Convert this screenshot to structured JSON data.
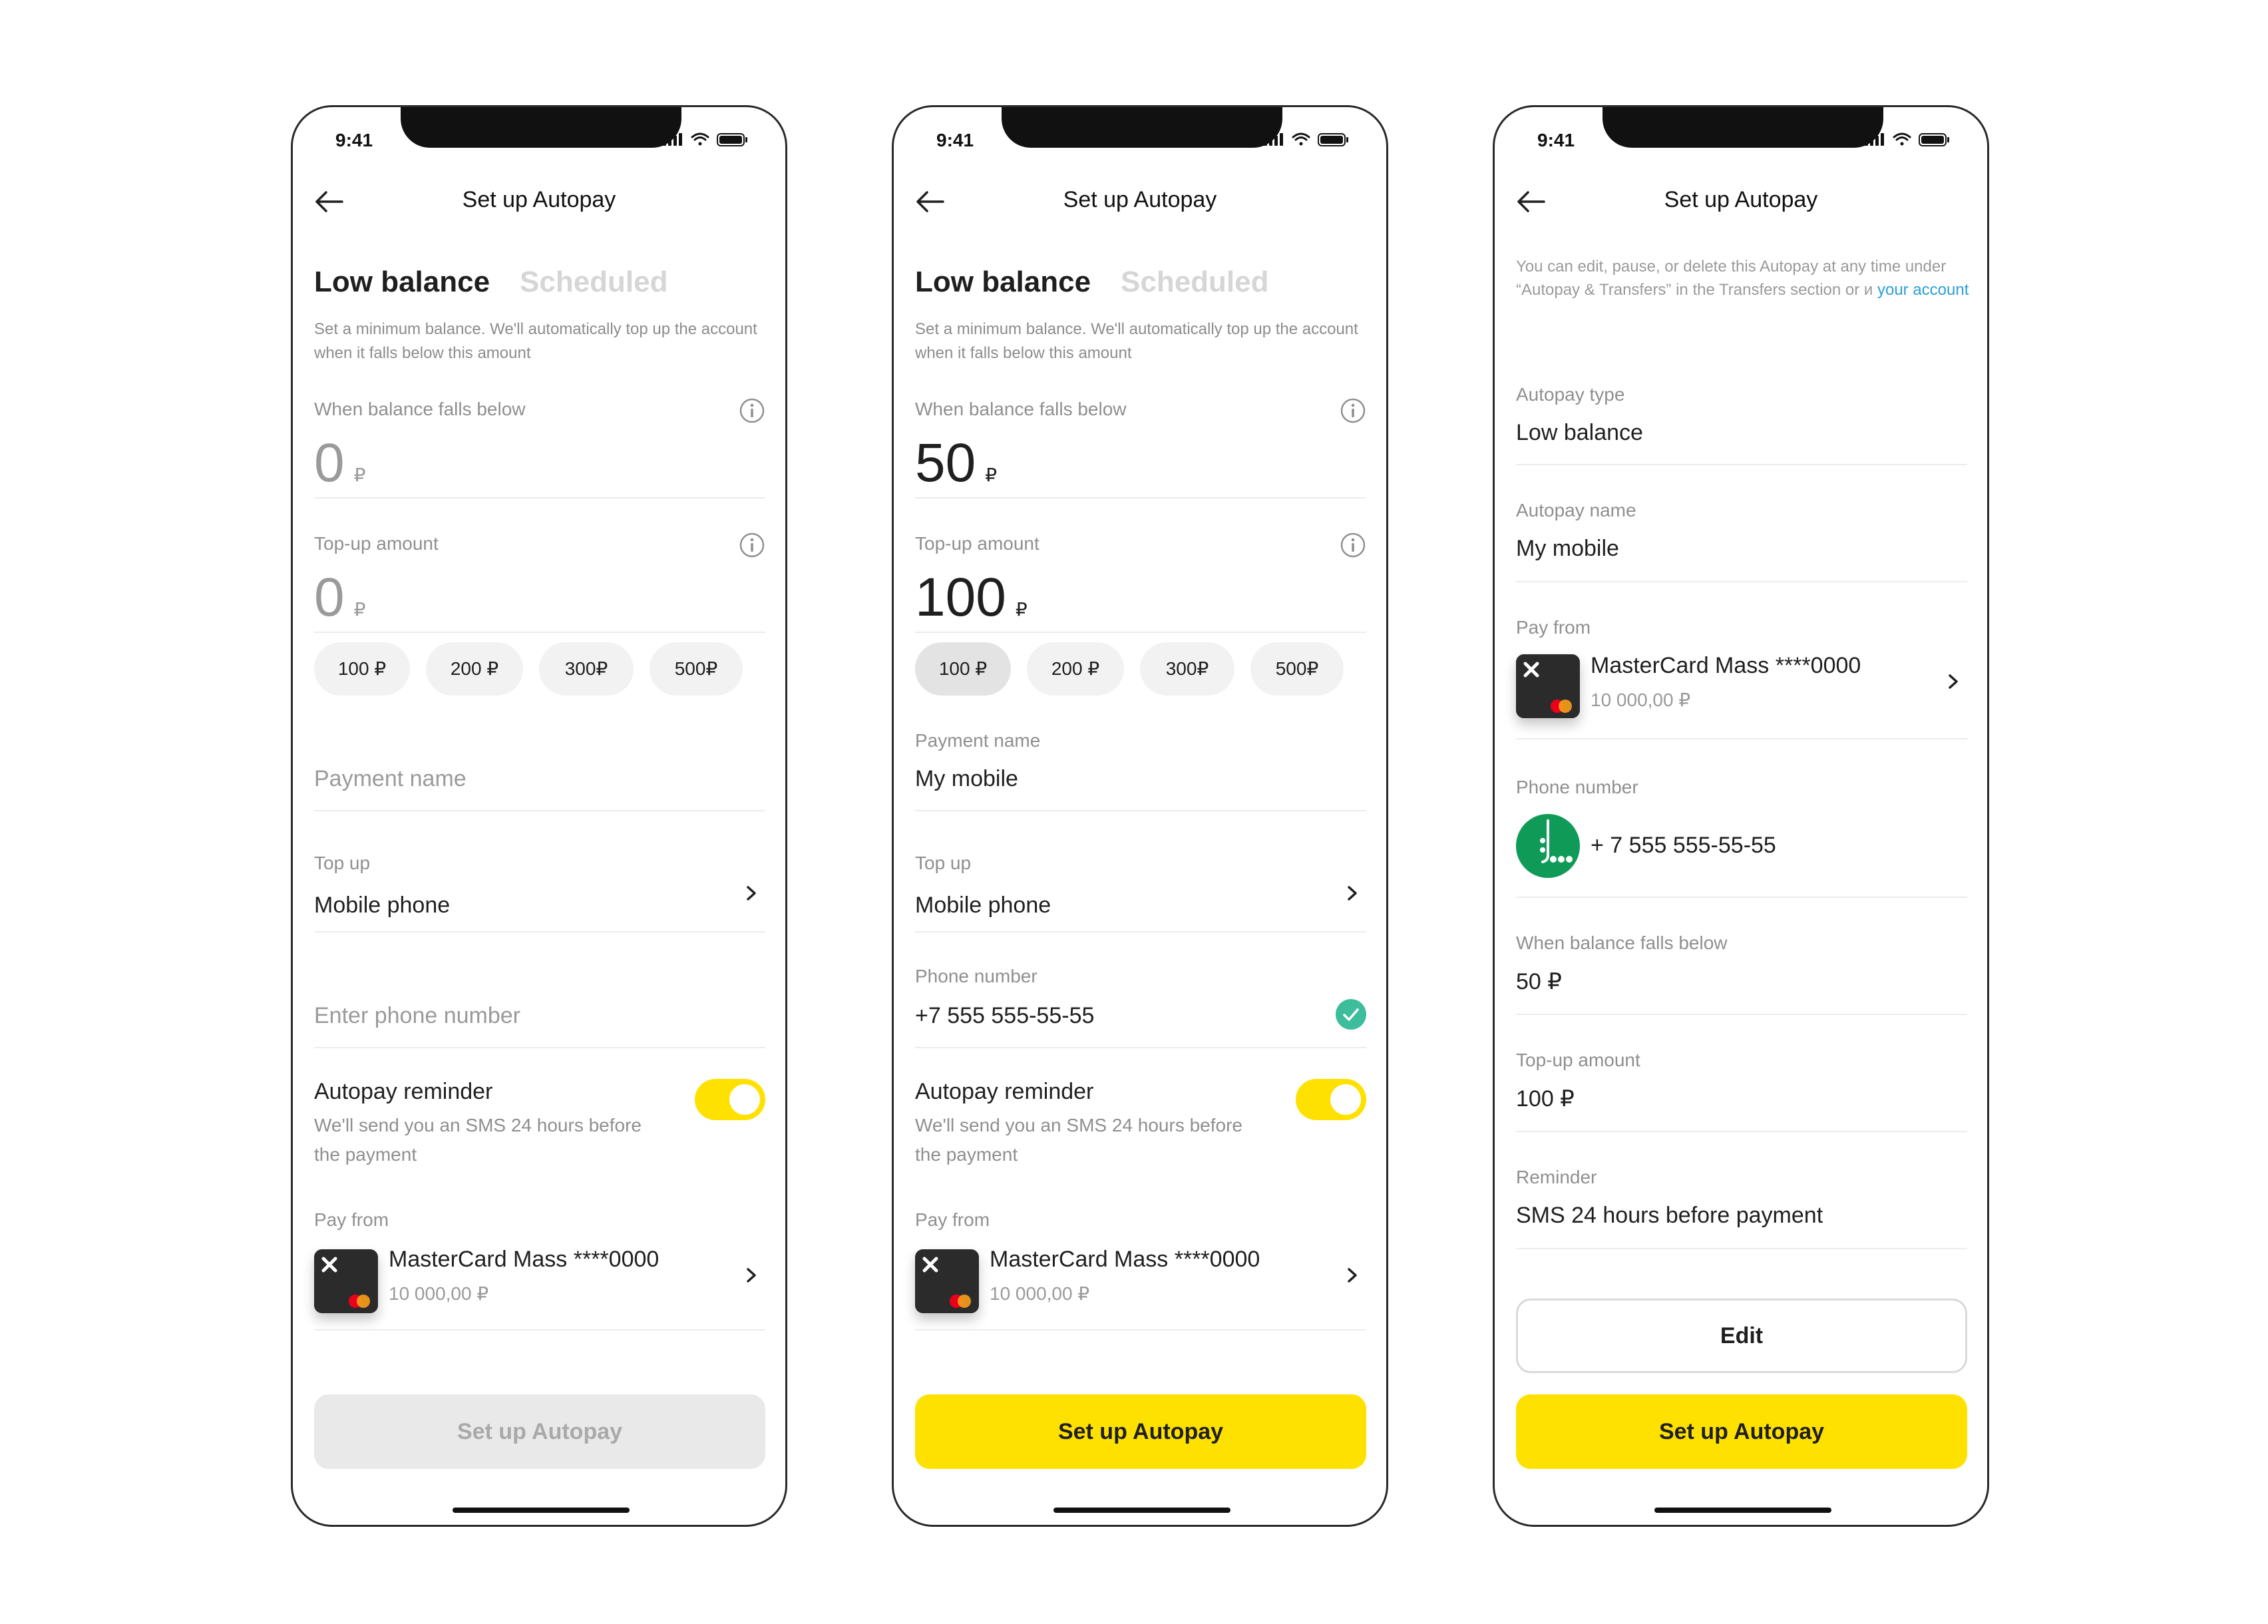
{
  "status_bar": {
    "time": "9:41"
  },
  "header": {
    "title": "Set up Autopay"
  },
  "tabs": {
    "active": "Low balance",
    "inactive": "Scheduled"
  },
  "description": "Set a minimum balance. We'll automatically top up the account when it falls below this amount",
  "labels": {
    "balance_below": "When balance falls below",
    "topup_amount": "Top-up amount",
    "payment_name": "Payment name",
    "top_up": "Top up",
    "phone_number": "Phone number",
    "enter_phone": "Enter phone number",
    "reminder_title": "Autopay reminder",
    "reminder_desc": "We'll send you an SMS 24 hours before the payment",
    "pay_from": "Pay from"
  },
  "currency": "₽",
  "chips": [
    "100 ₽",
    "200 ₽",
    "300₽",
    "500₽"
  ],
  "card": {
    "name": "MasterCard Mass ****0000",
    "balance": "10 000,00 ₽"
  },
  "screen1": {
    "balance_value": "0",
    "topup_value": "0",
    "top_up_value": "Mobile phone",
    "reminder_on": true,
    "button": "Set up Autopay"
  },
  "screen2": {
    "balance_value": "50",
    "topup_value": "100",
    "selected_chip": "100 ₽",
    "payment_name_value": "My mobile",
    "top_up_value": "Mobile phone",
    "phone_value": "+7 555 555-55-55",
    "phone_valid": true,
    "reminder_on": true,
    "button": "Set up Autopay"
  },
  "screen3": {
    "info_text": "You can edit, pause, or delete this Autopay at any time under “Autopay & Transfers” in the Transfers section or и",
    "info_link": "your account",
    "rows": [
      {
        "label": "Autopay type",
        "value": "Low balance"
      },
      {
        "label": "Autopay name",
        "value": "My mobile"
      }
    ],
    "pay_from_label": "Pay from",
    "phone_label": "Phone number",
    "phone_value": "+ 7 555 555-55-55",
    "rows2": [
      {
        "label": "When balance falls below",
        "value": "50 ₽"
      },
      {
        "label": "Top-up amount",
        "value": "100 ₽"
      },
      {
        "label": "Reminder",
        "value": "SMS 24 hours before payment"
      }
    ],
    "edit_button": "Edit",
    "button": "Set up Autopay"
  },
  "colors": {
    "accent": "#ffe100",
    "success": "#3dbd9b",
    "link": "#2a9fd6",
    "operator": "#0f9b57"
  },
  "icons": [
    "back-arrow-icon",
    "info-icon",
    "chevron-right-icon",
    "check-circle-icon",
    "card-icon",
    "mastercard-icon",
    "operator-logo-icon",
    "signal-icon",
    "wifi-icon",
    "battery-icon"
  ]
}
